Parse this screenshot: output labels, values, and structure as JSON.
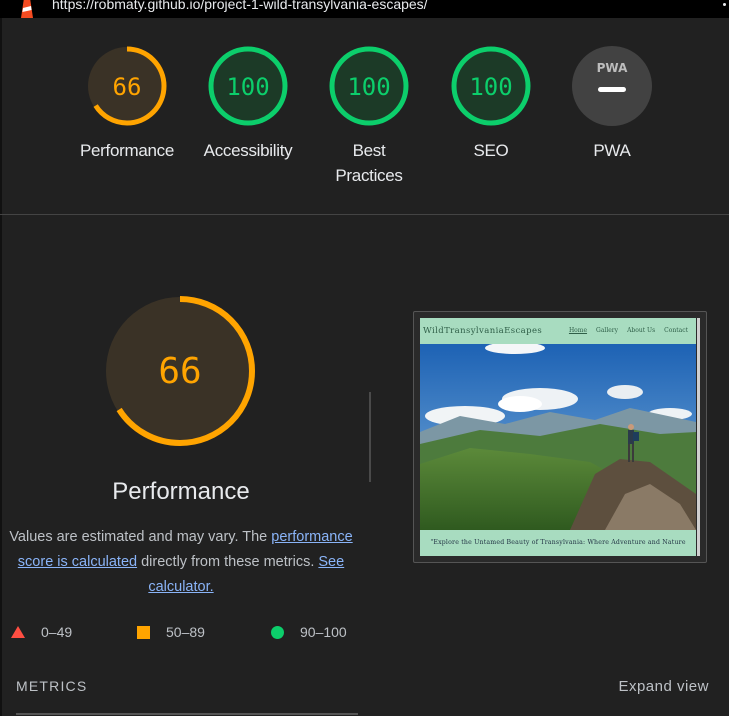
{
  "topbar": {
    "url": "https://robmaty.github.io/project-1-wild-transylvania-escapes/"
  },
  "scores": [
    {
      "label": "Performance",
      "value": "66",
      "fraction": 0.66,
      "color": "#ffa400"
    },
    {
      "label": "Accessibility",
      "value": "100",
      "fraction": 1.0,
      "color": "#0cce6b"
    },
    {
      "label": "Best Practices",
      "value": "100",
      "fraction": 1.0,
      "color": "#0cce6b"
    },
    {
      "label": "SEO",
      "value": "100",
      "fraction": 1.0,
      "color": "#0cce6b"
    },
    {
      "label": "PWA",
      "value": "",
      "badge": "PWA",
      "color": "#9aa0a6"
    }
  ],
  "main": {
    "score": "66",
    "fraction": 0.66,
    "title": "Performance",
    "note_prefix": "Values are estimated and may vary. The",
    "note_link": "performance score is calculated",
    "note_middle": "directly from these metrics.",
    "note_link2": "See calculator."
  },
  "legend": [
    {
      "range": "0–49",
      "icon": "fail-triangle-icon",
      "color": "#ff4e42"
    },
    {
      "range": "50–89",
      "icon": "average-square-icon",
      "color": "#ffa400"
    },
    {
      "range": "90–100",
      "icon": "pass-circle-icon",
      "color": "#0cce6b"
    }
  ],
  "metrics": {
    "title": "METRICS",
    "expand": "Expand view"
  },
  "screenshot": {
    "brand": "WildTransylvaniaEscapes",
    "links": [
      "Home",
      "Gallery",
      "About Us",
      "Contact"
    ],
    "caption": "\"Explore the Untamed Beauty of Transylvania: Where Adventure and Nature Converge\""
  }
}
